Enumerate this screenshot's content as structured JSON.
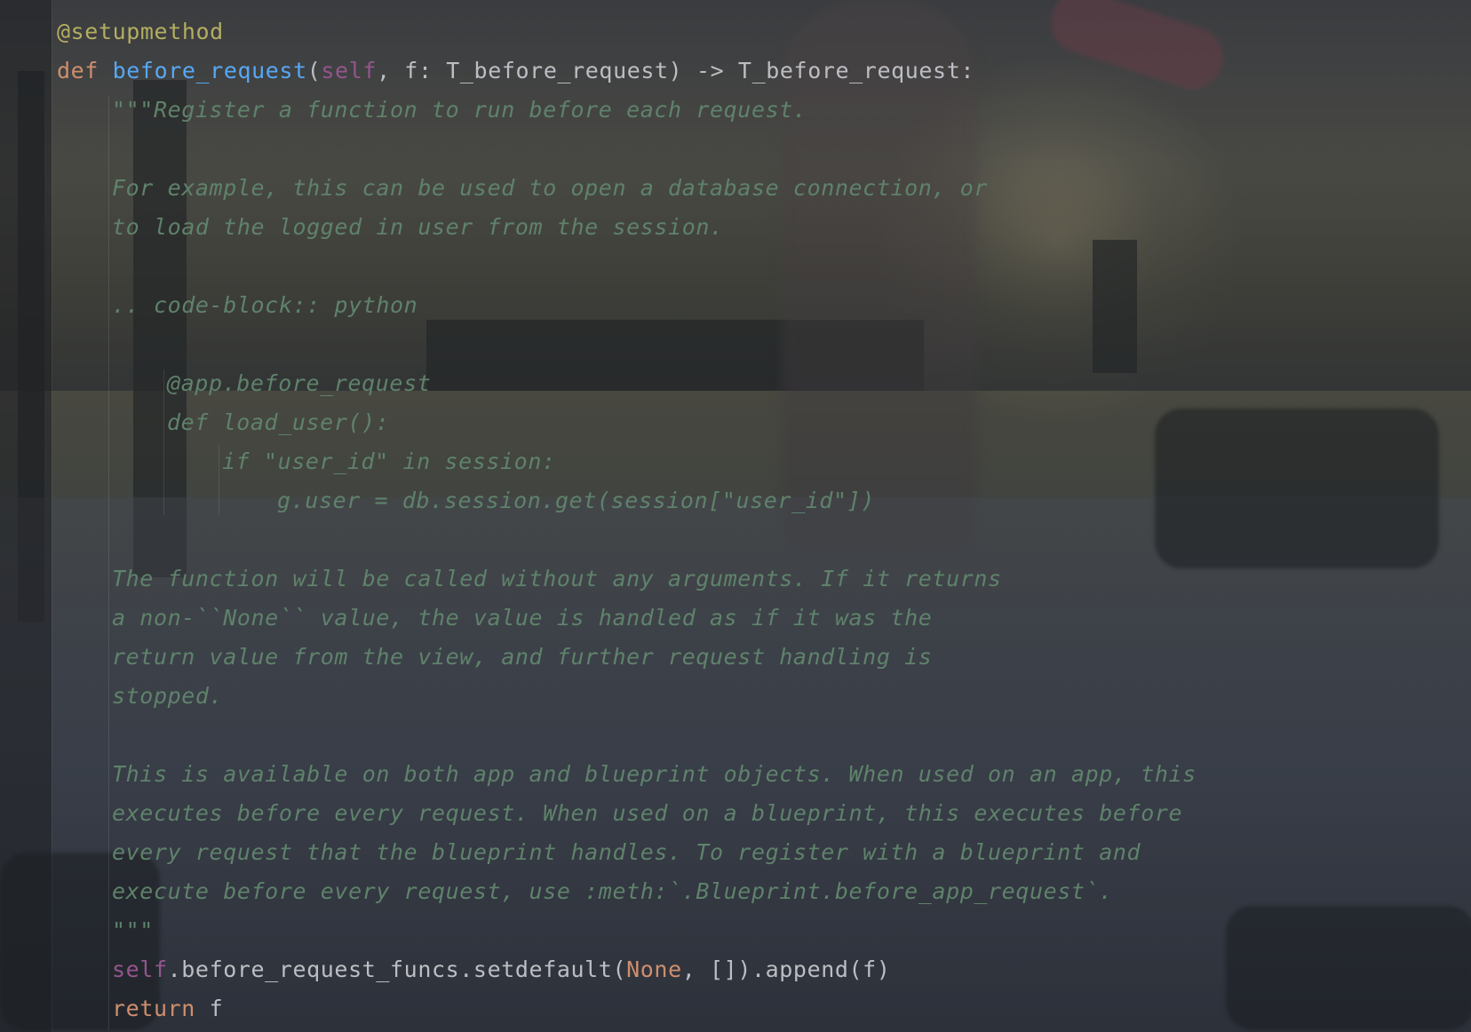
{
  "editor": {
    "lines": [
      {
        "indent": 0,
        "parts": [
          {
            "t": "@setupmethod",
            "c": "dec"
          }
        ]
      },
      {
        "indent": 0,
        "parts": [
          {
            "t": "def ",
            "c": "kw"
          },
          {
            "t": "before_request",
            "c": "fn"
          },
          {
            "t": "(",
            "c": "plain"
          },
          {
            "t": "self",
            "c": "self"
          },
          {
            "t": ", f: T_before_request) -> T_before_request:",
            "c": "plain"
          }
        ]
      },
      {
        "indent": 1,
        "parts": [
          {
            "t": "\"\"\"Register a function to run before each request.",
            "c": "doc"
          }
        ]
      },
      {
        "indent": 0,
        "parts": []
      },
      {
        "indent": 1,
        "parts": [
          {
            "t": "For example, this can be used to open a database connection, or",
            "c": "doc"
          }
        ]
      },
      {
        "indent": 1,
        "parts": [
          {
            "t": "to load the logged in user from the session.",
            "c": "doc"
          }
        ]
      },
      {
        "indent": 0,
        "parts": []
      },
      {
        "indent": 1,
        "parts": [
          {
            "t": ".. code-block:: python",
            "c": "doc"
          }
        ]
      },
      {
        "indent": 0,
        "parts": []
      },
      {
        "indent": 2,
        "parts": [
          {
            "t": "@app.before_request",
            "c": "doc"
          }
        ]
      },
      {
        "indent": 2,
        "parts": [
          {
            "t": "def load_user():",
            "c": "doc"
          }
        ]
      },
      {
        "indent": 3,
        "parts": [
          {
            "t": "if \"user_id\" in session:",
            "c": "doc"
          }
        ]
      },
      {
        "indent": 4,
        "parts": [
          {
            "t": "g.user = db.session.get(session[\"user_id\"])",
            "c": "doc"
          }
        ]
      },
      {
        "indent": 0,
        "parts": []
      },
      {
        "indent": 1,
        "parts": [
          {
            "t": "The function will be called without any arguments. If it returns",
            "c": "doc"
          }
        ]
      },
      {
        "indent": 1,
        "parts": [
          {
            "t": "a non-``None`` value, the value is handled as if it was the",
            "c": "doc"
          }
        ]
      },
      {
        "indent": 1,
        "parts": [
          {
            "t": "return value from the view, and further request handling is",
            "c": "doc"
          }
        ]
      },
      {
        "indent": 1,
        "parts": [
          {
            "t": "stopped.",
            "c": "doc"
          }
        ]
      },
      {
        "indent": 0,
        "parts": []
      },
      {
        "indent": 1,
        "parts": [
          {
            "t": "This is available on both app and blueprint objects. When used on an app, this",
            "c": "doc"
          }
        ]
      },
      {
        "indent": 1,
        "parts": [
          {
            "t": "executes before every request. When used on a blueprint, this executes before",
            "c": "doc"
          }
        ]
      },
      {
        "indent": 1,
        "parts": [
          {
            "t": "every request that the blueprint handles. To register with a blueprint and",
            "c": "doc"
          }
        ]
      },
      {
        "indent": 1,
        "parts": [
          {
            "t": "execute before every request, use :meth:`.Blueprint.before_app_request`.",
            "c": "doc"
          }
        ]
      },
      {
        "indent": 1,
        "parts": [
          {
            "t": "\"\"\"",
            "c": "doc"
          }
        ]
      },
      {
        "indent": 1,
        "parts": [
          {
            "t": "self",
            "c": "self"
          },
          {
            "t": ".before_request_funcs.setdefault(",
            "c": "plain"
          },
          {
            "t": "None",
            "c": "kw"
          },
          {
            "t": ", []).append(f)",
            "c": "plain"
          }
        ]
      },
      {
        "indent": 1,
        "parts": [
          {
            "t": "return",
            "c": "kw"
          },
          {
            "t": " f",
            "c": "plain"
          }
        ]
      }
    ]
  }
}
